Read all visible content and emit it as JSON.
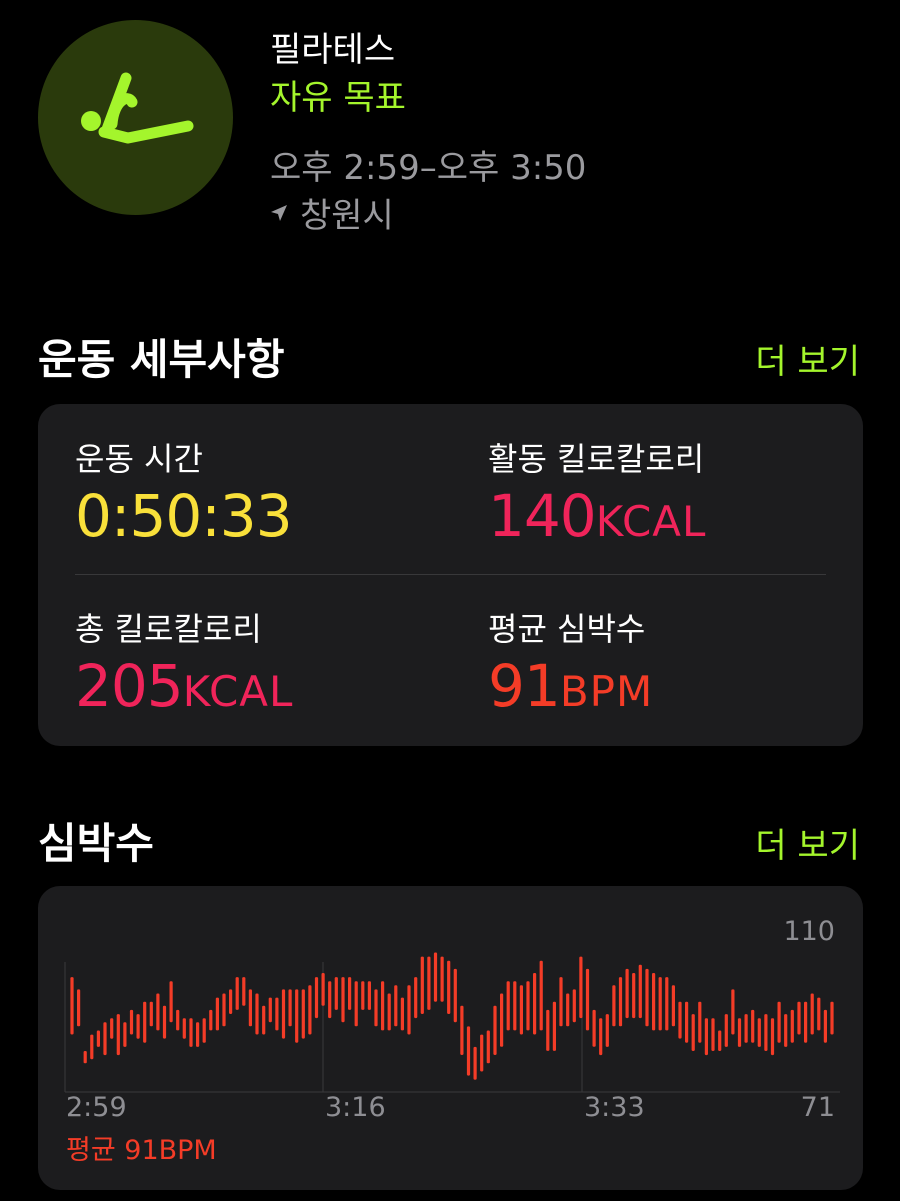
{
  "workout": {
    "title": "필라테스",
    "goal": "자유 목표",
    "time_range": "오후 2:59–오후 3:50",
    "location": "창원시",
    "accent_color": "#a4f52c",
    "icon": "pilates-figure-icon"
  },
  "details": {
    "title": "운동 세부사항",
    "more": "더 보기",
    "metrics": [
      {
        "label": "운동 시간",
        "value": "0:50:33",
        "unit": "",
        "color": "#f9e03a"
      },
      {
        "label": "활동 킬로칼로리",
        "value": "140",
        "unit": "KCAL",
        "color": "#f0245a"
      },
      {
        "label": "총 킬로칼로리",
        "value": "205",
        "unit": "KCAL",
        "color": "#f0245a"
      },
      {
        "label": "평균 심박수",
        "value": "91",
        "unit": "BPM",
        "color": "#f43c27"
      }
    ]
  },
  "heart_rate": {
    "title": "심박수",
    "more": "더 보기",
    "average_label": "평균 91BPM"
  },
  "chart_data": {
    "type": "bar",
    "title": "",
    "x_ticks": [
      "2:59",
      "3:16",
      "3:33"
    ],
    "y_max_label": "110",
    "y_min_label": "71",
    "ylim": [
      71,
      110
    ],
    "grid": true,
    "color": "#f43c27",
    "ranges": [
      [
        85,
        99
      ],
      [
        87,
        96
      ],
      [
        78,
        81
      ],
      [
        79,
        85
      ],
      [
        82,
        86
      ],
      [
        80,
        88
      ],
      [
        84,
        89
      ],
      [
        80,
        90
      ],
      [
        82,
        88
      ],
      [
        85,
        91
      ],
      [
        84,
        90
      ],
      [
        83,
        93
      ],
      [
        87,
        93
      ],
      [
        86,
        95
      ],
      [
        84,
        92
      ],
      [
        88,
        98
      ],
      [
        86,
        91
      ],
      [
        84,
        89
      ],
      [
        82,
        89
      ],
      [
        82,
        88
      ],
      [
        83,
        89
      ],
      [
        86,
        91
      ],
      [
        86,
        94
      ],
      [
        87,
        95
      ],
      [
        90,
        96
      ],
      [
        91,
        99
      ],
      [
        92,
        99
      ],
      [
        87,
        96
      ],
      [
        85,
        95
      ],
      [
        85,
        92
      ],
      [
        88,
        94
      ],
      [
        86,
        94
      ],
      [
        84,
        96
      ],
      [
        87,
        96
      ],
      [
        83,
        96
      ],
      [
        84,
        96
      ],
      [
        85,
        97
      ],
      [
        89,
        99
      ],
      [
        92,
        100
      ],
      [
        89,
        98
      ],
      [
        91,
        99
      ],
      [
        88,
        99
      ],
      [
        91,
        99
      ],
      [
        87,
        98
      ],
      [
        91,
        98
      ],
      [
        91,
        98
      ],
      [
        87,
        96
      ],
      [
        86,
        98
      ],
      [
        86,
        95
      ],
      [
        87,
        97
      ],
      [
        86,
        94
      ],
      [
        85,
        97
      ],
      [
        89,
        99
      ],
      [
        90,
        104
      ],
      [
        91,
        104
      ],
      [
        93,
        105
      ],
      [
        93,
        104
      ],
      [
        90,
        103
      ],
      [
        88,
        101
      ],
      [
        80,
        92
      ],
      [
        75,
        87
      ],
      [
        74,
        82
      ],
      [
        76,
        85
      ],
      [
        78,
        86
      ],
      [
        80,
        92
      ],
      [
        82,
        95
      ],
      [
        86,
        98
      ],
      [
        86,
        98
      ],
      [
        85,
        97
      ],
      [
        86,
        98
      ],
      [
        85,
        100
      ],
      [
        86,
        103
      ],
      [
        81,
        91
      ],
      [
        81,
        93
      ],
      [
        87,
        99
      ],
      [
        87,
        95
      ],
      [
        88,
        96
      ],
      [
        89,
        104
      ],
      [
        86,
        101
      ],
      [
        82,
        91
      ],
      [
        80,
        89
      ],
      [
        82,
        90
      ],
      [
        87,
        97
      ],
      [
        87,
        99
      ],
      [
        89,
        101
      ],
      [
        89,
        100
      ],
      [
        89,
        102
      ],
      [
        87,
        101
      ],
      [
        86,
        100
      ],
      [
        86,
        99
      ],
      [
        86,
        99
      ],
      [
        87,
        97
      ],
      [
        84,
        93
      ],
      [
        83,
        93
      ],
      [
        81,
        90
      ],
      [
        83,
        93
      ],
      [
        80,
        89
      ],
      [
        81,
        89
      ],
      [
        81,
        86
      ],
      [
        82,
        90
      ],
      [
        85,
        96
      ],
      [
        82,
        89
      ],
      [
        83,
        90
      ],
      [
        83,
        91
      ],
      [
        82,
        89
      ],
      [
        81,
        90
      ],
      [
        80,
        89
      ],
      [
        83,
        93
      ],
      [
        82,
        90
      ],
      [
        83,
        91
      ],
      [
        85,
        93
      ],
      [
        83,
        93
      ],
      [
        85,
        95
      ],
      [
        86,
        94
      ],
      [
        83,
        91
      ],
      [
        85,
        93
      ]
    ]
  }
}
